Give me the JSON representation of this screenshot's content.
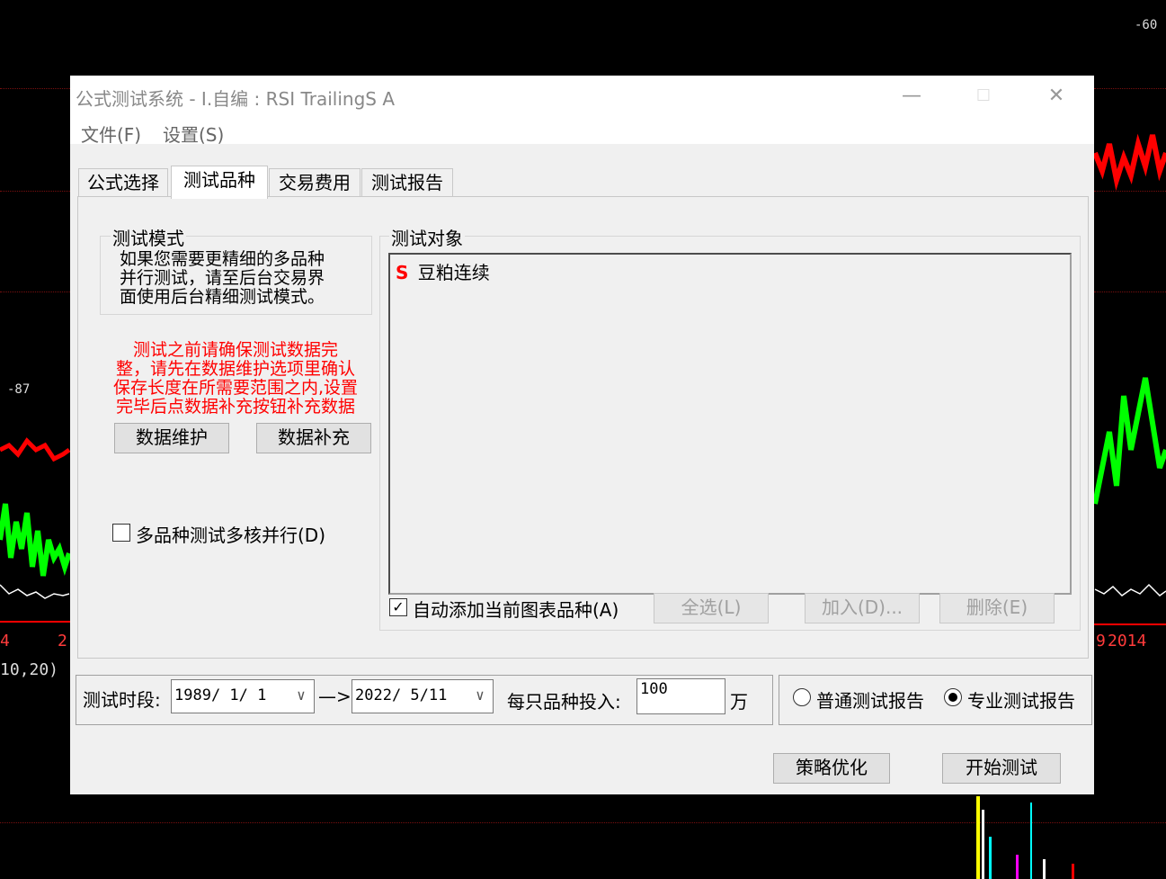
{
  "background": {
    "left_axis_year": "4",
    "left_axis_year2": "2",
    "indicator_params": "10,20)",
    "right_axis_year": "2014",
    "right_axis_prev": "9",
    "top_right_value": "-60",
    "left_marker_value": "-87"
  },
  "window": {
    "title": "公式测试系统 - I.自编 : RSI TrailingS A",
    "minimize_icon": "—",
    "maximize_icon": "☐",
    "close_icon": "✕"
  },
  "menu": {
    "items": [
      "文件(F)",
      "设置(S)"
    ]
  },
  "tabs": [
    {
      "label": "公式选择"
    },
    {
      "label": "测试品种"
    },
    {
      "label": "交易费用"
    },
    {
      "label": "测试报告"
    }
  ],
  "test_mode": {
    "group_label": "测试模式",
    "note_lines": [
      "如果您需要更精细的多品种",
      "并行测试，请至后台交易界",
      "面使用后台精细测试模式。"
    ]
  },
  "warning_lines": [
    "测试之前请确保测试数据完",
    "整，请先在数据维护选项里确认",
    "保存长度在所需要范围之内,设置",
    "完毕后点数据补充按钮补充数据"
  ],
  "buttons": {
    "data_maintain": "数据维护",
    "data_supplement": "数据补充",
    "select_all": "全选(L)",
    "add": "加入(D)...",
    "delete": "删除(E)",
    "strategy_optimize": "策略优化",
    "start_test": "开始测试"
  },
  "multicore": {
    "label": "多品种测试多核并行(D)",
    "checked": false
  },
  "test_objects": {
    "group_label": "测试对象",
    "items": [
      {
        "marker": "S",
        "name": "豆粕连续"
      }
    ]
  },
  "auto_add": {
    "label": "自动添加当前图表品种(A)",
    "checked": true
  },
  "period": {
    "label": "测试时段:",
    "start": "1989/ 1/ 1",
    "arrow": "—>",
    "end": "2022/ 5/11"
  },
  "investment": {
    "label": "每只品种投入:",
    "value": "100",
    "unit": "万"
  },
  "report_type": {
    "options": [
      "普通测试报告",
      "专业测试报告"
    ],
    "selected": "专业测试报告"
  },
  "colors": {
    "warning": "#ff0000",
    "marker": "#ff0000"
  }
}
